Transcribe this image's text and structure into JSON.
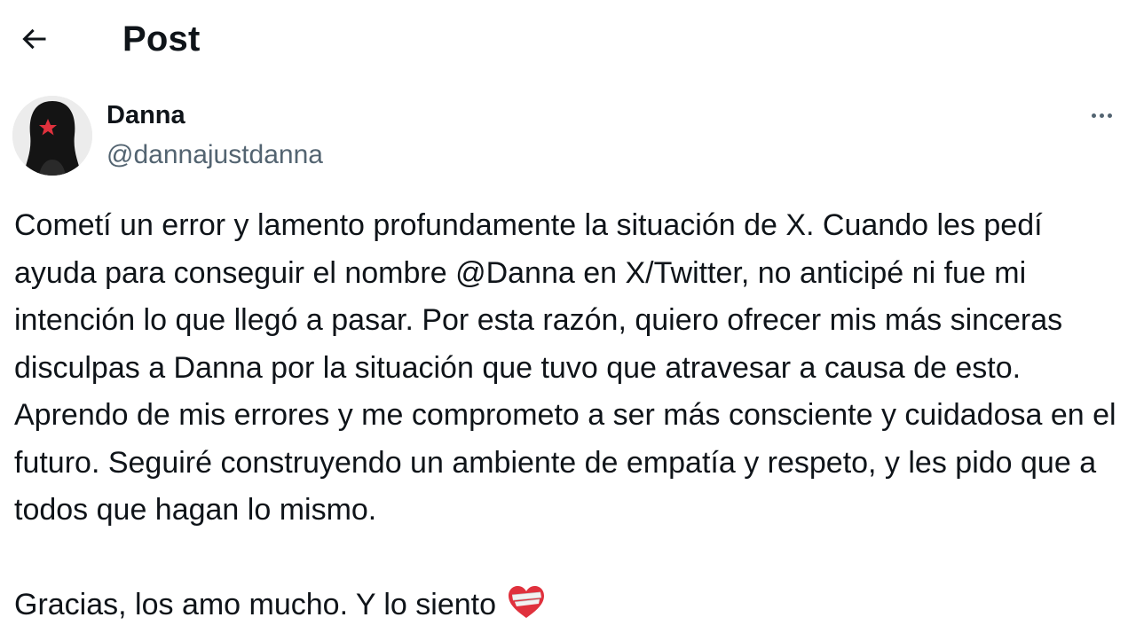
{
  "header": {
    "title": "Post",
    "back_icon": "arrow-left-icon"
  },
  "author": {
    "display_name": "Danna",
    "handle": "@dannajustdanna",
    "avatar_icon": "avatar-image",
    "more_icon": "more-horizontal-icon"
  },
  "post": {
    "paragraph_1": "Cometí un error y lamento profundamente la situación de X. Cuando les pedí ayuda para conseguir el nombre @Danna en X/Twitter, no anticipé ni fue mi intención lo que llegó a pasar. Por esta razón, quiero ofrecer mis más sinceras disculpas a Danna por la situación que tuvo que atravesar a causa de esto. Aprendo de mis errores y me comprometo a ser más consciente y cuidadosa en el futuro. Seguiré construyendo un ambiente de empatía y respeto, y les pido que a todos que hagan lo mismo.",
    "paragraph_2": "Gracias, los amo mucho. Y lo siento",
    "emoji": "mending-heart-emoji"
  },
  "colors": {
    "text_primary": "#0f1419",
    "text_secondary": "#536471",
    "background": "#ffffff",
    "heart_red": "#e0313d"
  }
}
